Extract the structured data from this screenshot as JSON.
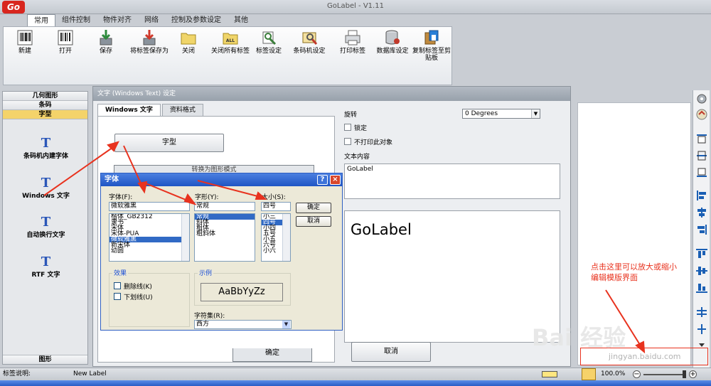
{
  "app": {
    "title": "GoLabel - V1.11",
    "logo_text": "Go"
  },
  "menu_tabs": [
    {
      "label": "常用"
    },
    {
      "label": "组件控制"
    },
    {
      "label": "物件对齐"
    },
    {
      "label": "网络"
    },
    {
      "label": "控制及参数设定"
    },
    {
      "label": "其他"
    }
  ],
  "ribbon": {
    "buttons": [
      {
        "label": "新建",
        "icon": "barcode-new-icon"
      },
      {
        "label": "打开",
        "icon": "barcode-open-icon"
      },
      {
        "label": "保存",
        "icon": "save-arrow-icon"
      },
      {
        "label": "将标签保存为",
        "icon": "save-as-icon"
      },
      {
        "label": "关闭",
        "icon": "folder-close-icon"
      },
      {
        "label": "关闭所有标签",
        "icon": "folder-all-icon",
        "badge": "ALL"
      },
      {
        "label": "标签设定",
        "icon": "label-settings-icon"
      },
      {
        "label": "条码机设定",
        "icon": "printer-settings-icon"
      },
      {
        "label": "打印标签",
        "icon": "print-icon"
      },
      {
        "label": "数据库设定",
        "icon": "database-icon"
      },
      {
        "label": "复制标签至剪贴板",
        "icon": "clipboard-icon"
      }
    ]
  },
  "left_panel": {
    "headers": [
      "几何图形",
      "条码",
      "字型"
    ],
    "items": [
      {
        "glyph": "T",
        "label": "条码机内建字体"
      },
      {
        "glyph": "T",
        "label": "Windows 文字"
      },
      {
        "glyph": "T",
        "label": "自动换行文字"
      },
      {
        "glyph": "T",
        "label": "RTF 文字"
      }
    ],
    "bottom": "图形"
  },
  "text_dialog": {
    "title": "文字 (Windows Text) 设定",
    "tabs": [
      "Windows 文字",
      "资料格式"
    ],
    "font_button": "字型",
    "hidden_button": "转换为图形模式",
    "rotate_label": "旋转",
    "rotate_value": "0 Degrees",
    "lock_label": "锁定",
    "noprint_label": "不打印此对象",
    "content_label": "文本内容",
    "content_value": "GoLabel",
    "preview_text": "GoLabel",
    "ok": "确定",
    "cancel": "取消"
  },
  "font_dialog": {
    "title": "字体",
    "font_label": "字体(F):",
    "style_label": "字形(Y):",
    "size_label": "大小(S):",
    "font_value": "微软雅黑",
    "style_value": "常规",
    "size_value": "四号",
    "fonts": [
      "楷体_GB2312",
      "隶书",
      "宋体",
      "宋体-PUA",
      "微软雅黑",
      "新宋体",
      "幼圆"
    ],
    "fonts_selected": 4,
    "styles": [
      "常规",
      "斜体",
      "粗体",
      "粗斜体"
    ],
    "styles_selected": 0,
    "sizes": [
      "小三",
      "四号",
      "小四",
      "五号",
      "小五",
      "六号",
      "小六"
    ],
    "sizes_selected": 1,
    "ok": "确定",
    "cancel": "取消",
    "effects_title": "效果",
    "strike_label": "删除线(K)",
    "underline_label": "下划线(U)",
    "sample_title": "示例",
    "sample_text": "AaBbYyZz",
    "charset_label": "字符集(R):",
    "charset_value": "西方",
    "help": "?",
    "close": "×"
  },
  "annotation": {
    "text_line1": "点击这里可以放大或缩小",
    "text_line2": "编辑模版界面",
    "color": "#e8321e"
  },
  "statusbar": {
    "label": "标签说明:",
    "file": "New Label",
    "zoom": "100.0%"
  },
  "watermark": {
    "brand": "Bai 经验",
    "url": "jingyan.baidu.com"
  }
}
